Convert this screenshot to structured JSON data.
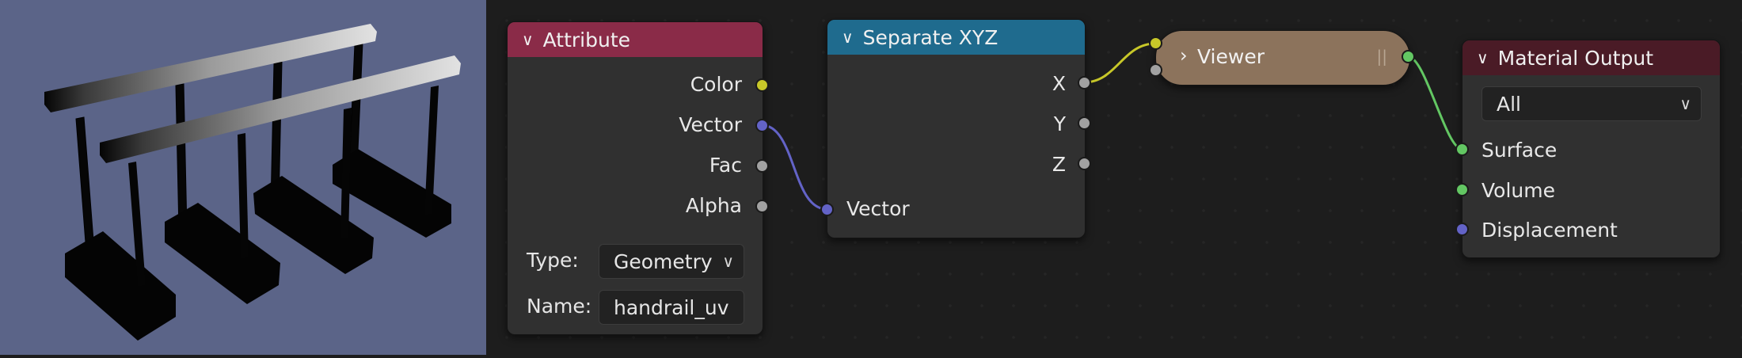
{
  "nodes": {
    "attribute": {
      "title": "Attribute",
      "outputs": [
        "Color",
        "Vector",
        "Fac",
        "Alpha"
      ],
      "type_label": "Type:",
      "type_value": "Geometry",
      "name_label": "Name:",
      "name_value": "handrail_uv"
    },
    "separate_xyz": {
      "title": "Separate XYZ",
      "outputs": [
        "X",
        "Y",
        "Z"
      ],
      "input": "Vector"
    },
    "viewer": {
      "title": "Viewer"
    },
    "material_output": {
      "title": "Material Output",
      "target_value": "All",
      "inputs": [
        "Surface",
        "Volume",
        "Displacement"
      ]
    }
  },
  "colors": {
    "viewport_bg": "#5b6488",
    "editor_bg": "#1d1d1d",
    "attribute_header": "#8a2b48",
    "separate_header": "#1f6b8e",
    "viewer_body": "#8c735c",
    "material_header": "#4a1b26",
    "socket_color": "#c7c729",
    "socket_vector": "#6363c7",
    "socket_float": "#a1a1a1",
    "socket_shader": "#63c763"
  },
  "icons": {
    "collapse": "chevron-down-icon",
    "dropdown": "chevron-down-icon",
    "viewer_expand": "chevron-right-icon"
  }
}
